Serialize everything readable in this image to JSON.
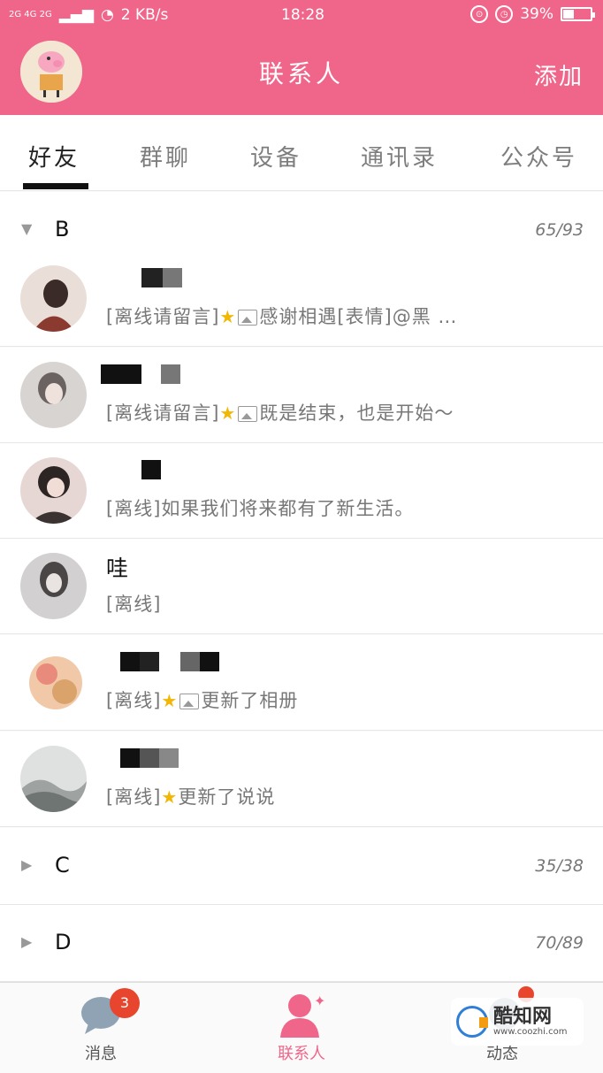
{
  "status_bar": {
    "network": "2G 4G 2G",
    "speed": "2 KB/s",
    "time": "18:28",
    "battery": "39%",
    "battery_fraction": 0.39
  },
  "header": {
    "title": "联系人",
    "add_label": "添加"
  },
  "tabs": [
    "好友",
    "群聊",
    "设备",
    "通讯录",
    "公众号"
  ],
  "groups": [
    {
      "name": "B",
      "count": "65/93"
    },
    {
      "name": "C",
      "count": "35/38"
    },
    {
      "name": "D",
      "count": "70/89"
    }
  ],
  "contacts": [
    {
      "name": "",
      "status": "[离线请留言]",
      "message": "感谢相遇[表情]@黑 …",
      "has_star": true,
      "has_image": true
    },
    {
      "name": "",
      "status": "[离线请留言]",
      "message": "既是结束，也是开始～",
      "has_star": true,
      "has_image": true
    },
    {
      "name": "",
      "status": "[离线]",
      "message": "如果我们将来都有了新生活。",
      "has_star": false,
      "has_image": false
    },
    {
      "name": "哇",
      "status": "[离线]",
      "message": "",
      "has_star": false,
      "has_image": false
    },
    {
      "name": "",
      "status": "[离线]",
      "message": "更新了相册",
      "has_star": true,
      "has_image": true
    },
    {
      "name": "",
      "status": "[离线]",
      "message": "更新了说说",
      "has_star": true,
      "has_image": false
    }
  ],
  "bottom_nav": [
    {
      "label": "消息",
      "badge": "3"
    },
    {
      "label": "联系人"
    },
    {
      "label": "动态"
    }
  ],
  "watermark": {
    "text": "酷知网",
    "url": "www.coozhi.com"
  },
  "colors": {
    "accent": "#f0668a",
    "badge": "#e8452f",
    "star": "#f2b705"
  }
}
